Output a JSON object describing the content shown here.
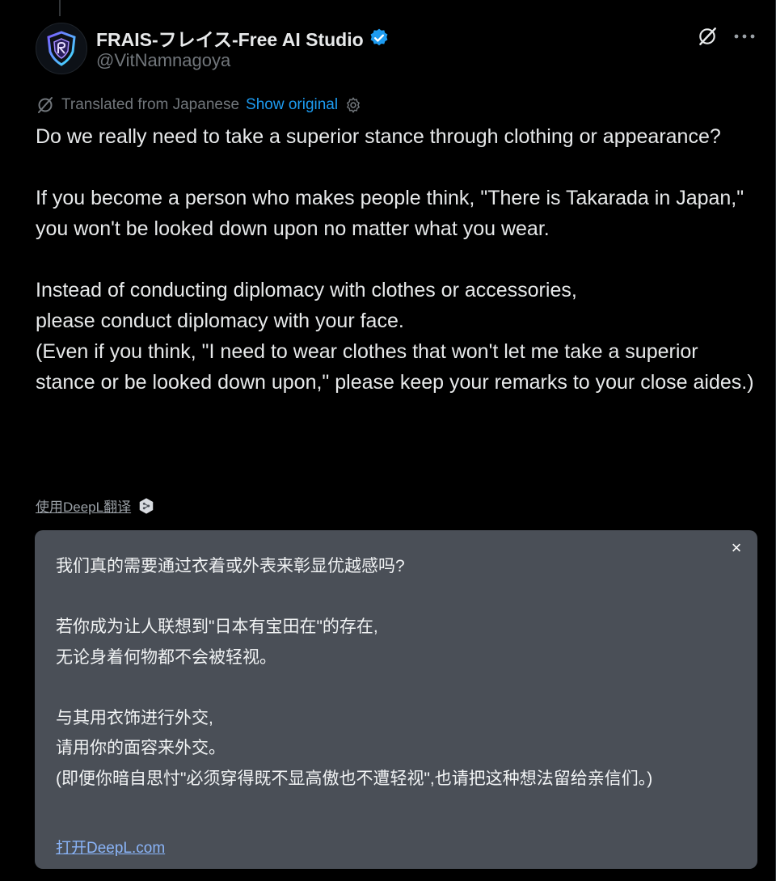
{
  "author": {
    "name": "FRAIS-フレイス-Free AI Studio",
    "handle": "@VitNamnagoya",
    "verified": true
  },
  "icons": {
    "avatar": "shield-logo-icon",
    "verified": "verified-badge-icon",
    "grok": "grok-icon",
    "more": "more-options-icon",
    "translate": "translate-icon",
    "settings": "gear-icon",
    "deepl": "deepl-icon",
    "close": "close-icon"
  },
  "translation_bar": {
    "label": "Translated from Japanese",
    "show_original": "Show original"
  },
  "tweet": {
    "text": "Do we really need to take a superior stance through clothing or appearance?\n\nIf you become a person who makes people think, \"There is Takarada in Japan,\"\nyou won't be looked down upon no matter what you wear.\n\nInstead of conducting diplomacy with clothes or accessories,\nplease conduct diplomacy with your face.\n(Even if you think, \"I need to wear clothes that won't let me take a superior stance or be looked down upon,\" please keep your remarks to your close aides.)"
  },
  "deepl": {
    "use_label": "使用DeepL翻译",
    "panel_text": "我们真的需要通过衣着或外表来彰显优越感吗?\n\n若你成为让人联想到\"日本有宝田在\"的存在,\n无论身着何物都不会被轻视。\n\n与其用衣饰进行外交,\n请用你的面容来外交。\n(即便你暗自思忖\"必须穿得既不显高傲也不遭轻视\",也请把这种想法留给亲信们。)",
    "close_symbol": "×",
    "open_link": "打开DeepL.com"
  },
  "colors": {
    "background": "#000000",
    "link": "#1d9bf0",
    "panel": "#4a4f57"
  }
}
